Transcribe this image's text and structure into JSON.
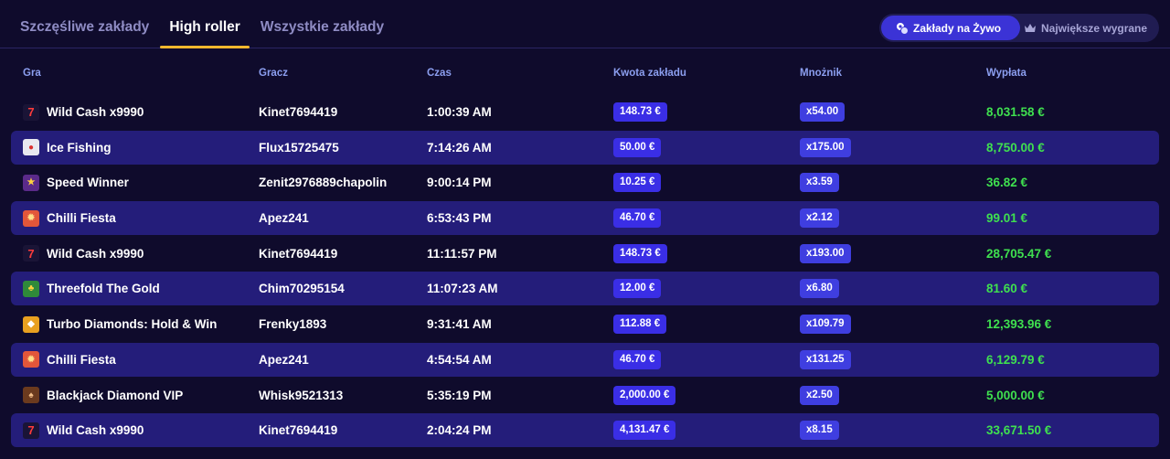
{
  "tabs": [
    {
      "label": "Szczęśliwe zakłady",
      "active": false
    },
    {
      "label": "High roller",
      "active": true
    },
    {
      "label": "Wszystkie zakłady",
      "active": false
    }
  ],
  "toggle": {
    "live_label": "Zakłady na Żywo",
    "biggest_label": "Największe wygrane"
  },
  "columns": {
    "game": "Gra",
    "player": "Gracz",
    "time": "Czas",
    "amount": "Kwota zakładu",
    "multiplier": "Mnożnik",
    "payout": "Wypłata"
  },
  "colors": {
    "accent": "#f5b82e",
    "pill": "#3a2ee6",
    "payout": "#3fe04f",
    "row_alt": "#241d7a"
  },
  "rows": [
    {
      "game": "Wild Cash x9990",
      "icon": "seven-icon",
      "player": "Kinet7694419",
      "time": "1:00:39 AM",
      "amount": "148.73 €",
      "multiplier": "x54.00",
      "payout": "8,031.58 €"
    },
    {
      "game": "Ice Fishing",
      "icon": "fishing-icon",
      "player": "Flux15725475",
      "time": "7:14:26 AM",
      "amount": "50.00 €",
      "multiplier": "x175.00",
      "payout": "8,750.00 €"
    },
    {
      "game": "Speed Winner",
      "icon": "speed-icon",
      "player": "Zenit2976889chapolin",
      "time": "9:00:14 PM",
      "amount": "10.25 €",
      "multiplier": "x3.59",
      "payout": "36.82 €"
    },
    {
      "game": "Chilli Fiesta",
      "icon": "chilli-icon",
      "player": "Apez241",
      "time": "6:53:43 PM",
      "amount": "46.70 €",
      "multiplier": "x2.12",
      "payout": "99.01 €"
    },
    {
      "game": "Wild Cash x9990",
      "icon": "seven-icon",
      "player": "Kinet7694419",
      "time": "11:11:57 PM",
      "amount": "148.73 €",
      "multiplier": "x193.00",
      "payout": "28,705.47 €"
    },
    {
      "game": "Threefold The Gold",
      "icon": "leprechaun-icon",
      "player": "Chim70295154",
      "time": "11:07:23 AM",
      "amount": "12.00 €",
      "multiplier": "x6.80",
      "payout": "81.60 €"
    },
    {
      "game": "Turbo Diamonds: Hold & Win",
      "icon": "diamond-icon",
      "player": "Frenky1893",
      "time": "9:31:41 AM",
      "amount": "112.88 €",
      "multiplier": "x109.79",
      "payout": "12,393.96 €"
    },
    {
      "game": "Chilli Fiesta",
      "icon": "chilli-icon",
      "player": "Apez241",
      "time": "4:54:54 AM",
      "amount": "46.70 €",
      "multiplier": "x131.25",
      "payout": "6,129.79 €"
    },
    {
      "game": "Blackjack Diamond VIP",
      "icon": "dealer-icon",
      "player": "Whisk9521313",
      "time": "5:35:19 PM",
      "amount": "2,000.00 €",
      "multiplier": "x2.50",
      "payout": "5,000.00 €"
    },
    {
      "game": "Wild Cash x9990",
      "icon": "seven-icon",
      "player": "Kinet7694419",
      "time": "2:04:24 PM",
      "amount": "4,131.47 €",
      "multiplier": "x8.15",
      "payout": "33,671.50 €"
    }
  ]
}
